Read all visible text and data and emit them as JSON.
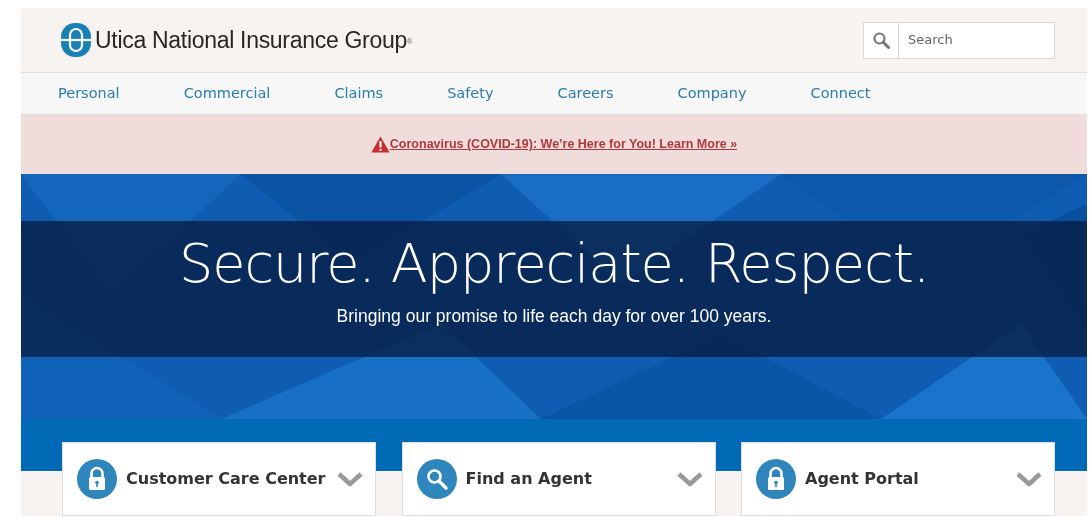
{
  "header": {
    "brand": "Utica National Insurance Group$^{®}$",
    "search": {
      "placeholder": "Search"
    }
  },
  "nav": [
    {
      "label": "Personal"
    },
    {
      "label": "Commercial"
    },
    {
      "label": "Claims"
    },
    {
      "label": "Safety"
    },
    {
      "label": "Careers"
    },
    {
      "label": "Company"
    },
    {
      "label": "Connect"
    }
  ],
  "alert": {
    "text": "Coronavirus (COVID-19): We’re Here for You! Learn More »"
  },
  "hero": {
    "title": "Secure. Appreciate. Respect.",
    "subtitle": "Bringing our promise to life each day for over 100 years."
  },
  "cards": [
    {
      "kind": "lock",
      "label": "Customer Care Center"
    },
    {
      "kind": "search",
      "label": "Find an Agent"
    },
    {
      "kind": "lock",
      "label": "Agent Portal"
    }
  ]
}
